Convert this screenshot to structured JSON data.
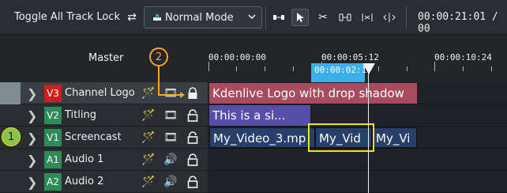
{
  "toolbar": {
    "toggle_lock_label": "Toggle All Track Lock",
    "mode_value": "Normal Mode",
    "timecode": "00:00:21:01 / 00"
  },
  "timeline": {
    "master_label": "Master",
    "ruler_labels": [
      "00:00:00:00",
      "00:00:05:12",
      "00:00:10:24"
    ],
    "zone_label": "00:00:02:1",
    "tracks": [
      {
        "tag": "V3",
        "name": "Channel Logo"
      },
      {
        "tag": "V2",
        "name": "Titling"
      },
      {
        "tag": "V1",
        "name": "Screencast"
      },
      {
        "tag": "A1",
        "name": "Audio 1"
      },
      {
        "tag": "A2",
        "name": "Audio 2"
      }
    ],
    "clips": {
      "logo": "Kdenlive Logo with drop shadow",
      "title": "This is a si...",
      "video1": "My_Video_3.mp",
      "video2": "My_Vid",
      "video3": "My_Vi"
    }
  },
  "annotations": {
    "callout_2": "2",
    "badge_1": "1"
  },
  "colors": {
    "accent": "#3daee9",
    "v3_tag": "#d11d1d",
    "track_tag": "#2e8b57",
    "callout": "#f5a623",
    "selection": "#f5e11b"
  }
}
